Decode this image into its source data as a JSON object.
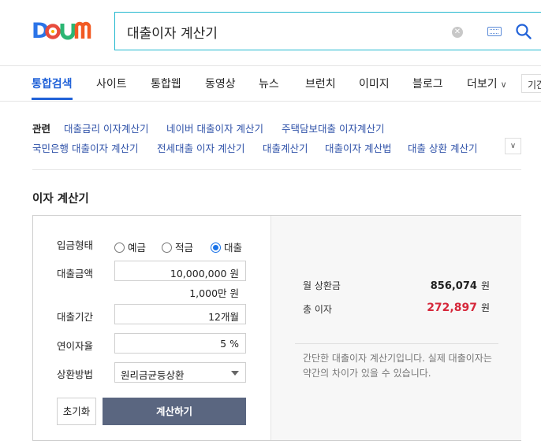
{
  "search": {
    "query": "대출이자 계산기"
  },
  "tabs": [
    {
      "label": "통합검색"
    },
    {
      "label": "사이트"
    },
    {
      "label": "통합웹"
    },
    {
      "label": "동영상"
    },
    {
      "label": "뉴스"
    },
    {
      "label": "브런치"
    },
    {
      "label": "이미지"
    },
    {
      "label": "블로그"
    },
    {
      "label": "더보기"
    }
  ],
  "period_filter": "기간",
  "related": {
    "title": "관련",
    "links": [
      "대출금리 이자계산기",
      "네이버 대출이자 계산기",
      "주택담보대출 이자계산기",
      "국민은행 대출이자 계산기",
      "전세대출 이자 계산기",
      "대출계산기",
      "대출이자 계산법",
      "대출 상환 계산기"
    ]
  },
  "calculator": {
    "title": "이자 계산기",
    "deposit_type_label": "입금형태",
    "radios": [
      {
        "label": "예금",
        "checked": false
      },
      {
        "label": "적금",
        "checked": false
      },
      {
        "label": "대출",
        "checked": true
      }
    ],
    "amount_label": "대출금액",
    "amount_value": "10,000,000",
    "amount_unit": "원",
    "amount_hint": "1,000만 원",
    "period_label": "대출기간",
    "period_value": "12개월",
    "rate_label": "연이자율",
    "rate_value": "5",
    "rate_unit": "%",
    "method_label": "상환방법",
    "method_value": "원리금균등상환",
    "reset_label": "초기화",
    "calc_label": "계산하기"
  },
  "result": {
    "monthly_label": "월 상환금",
    "monthly_value": "856,074",
    "monthly_unit": "원",
    "total_label": "총 이자",
    "total_value": "272,897",
    "total_unit": "원",
    "note": "간단한 대출이자 계산기입니다. 실제 대출이자는 약간의 차이가 있을 수 있습니다."
  },
  "colors": {
    "brand_blue": "#2162d8",
    "search_border": "#22b8cf",
    "result_red": "#d6283b",
    "button_dark": "#5a6680"
  }
}
